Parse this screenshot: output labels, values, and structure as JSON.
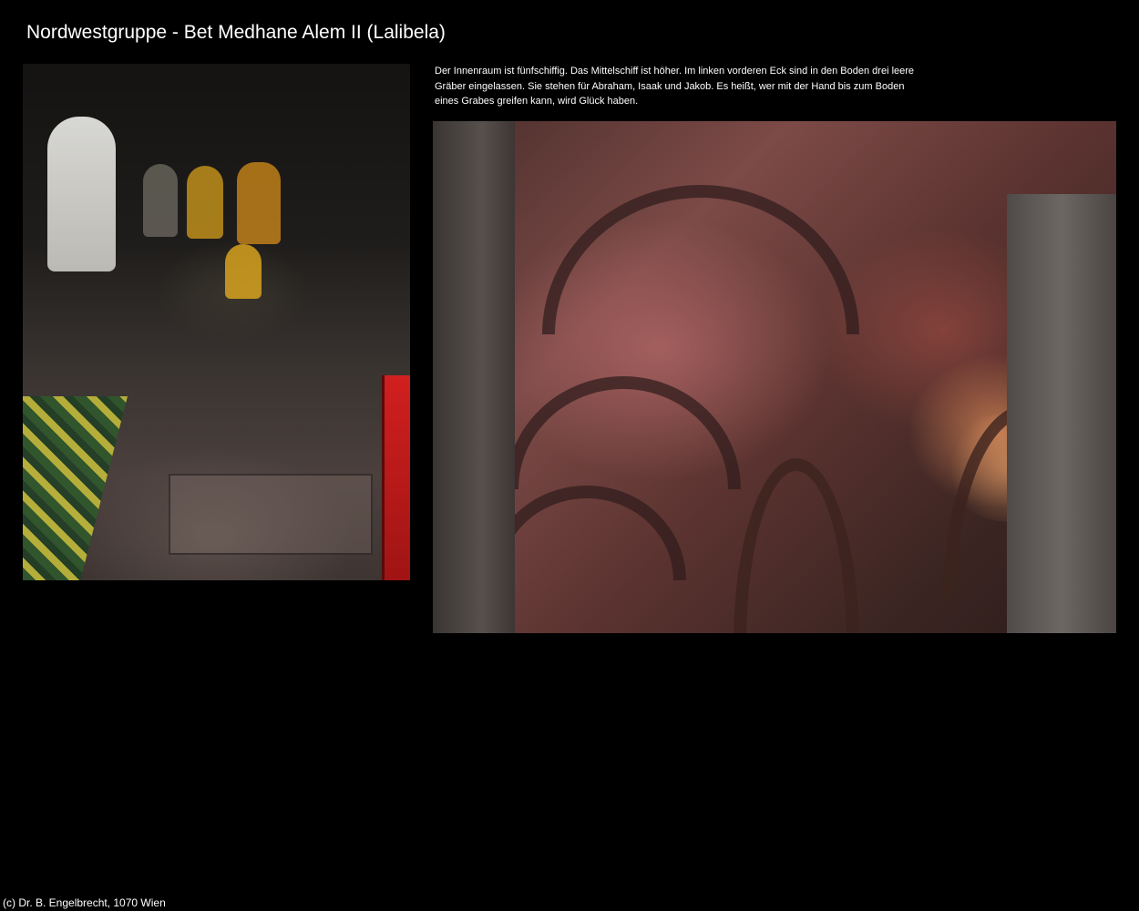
{
  "page": {
    "title": "Nordwestgruppe - Bet Medhane Alem II (Lalibela)",
    "background_color": "#000000",
    "text_color": "#ffffff"
  },
  "content": {
    "caption": "Der Innenraum ist fünfschiffig. Das Mittelschiff ist höher. Im linken vorderen Eck sind in den Boden drei leere Gräber eingelassen. Sie stehen für Abraham, Isaak und Jakob. Es heißt, wer mit der Hand bis zum Boden eines Grabes greifen kann, wird Glück haben."
  },
  "footer": {
    "copyright": "(c) Dr. B. Engelbrecht, 1070 Wien"
  }
}
